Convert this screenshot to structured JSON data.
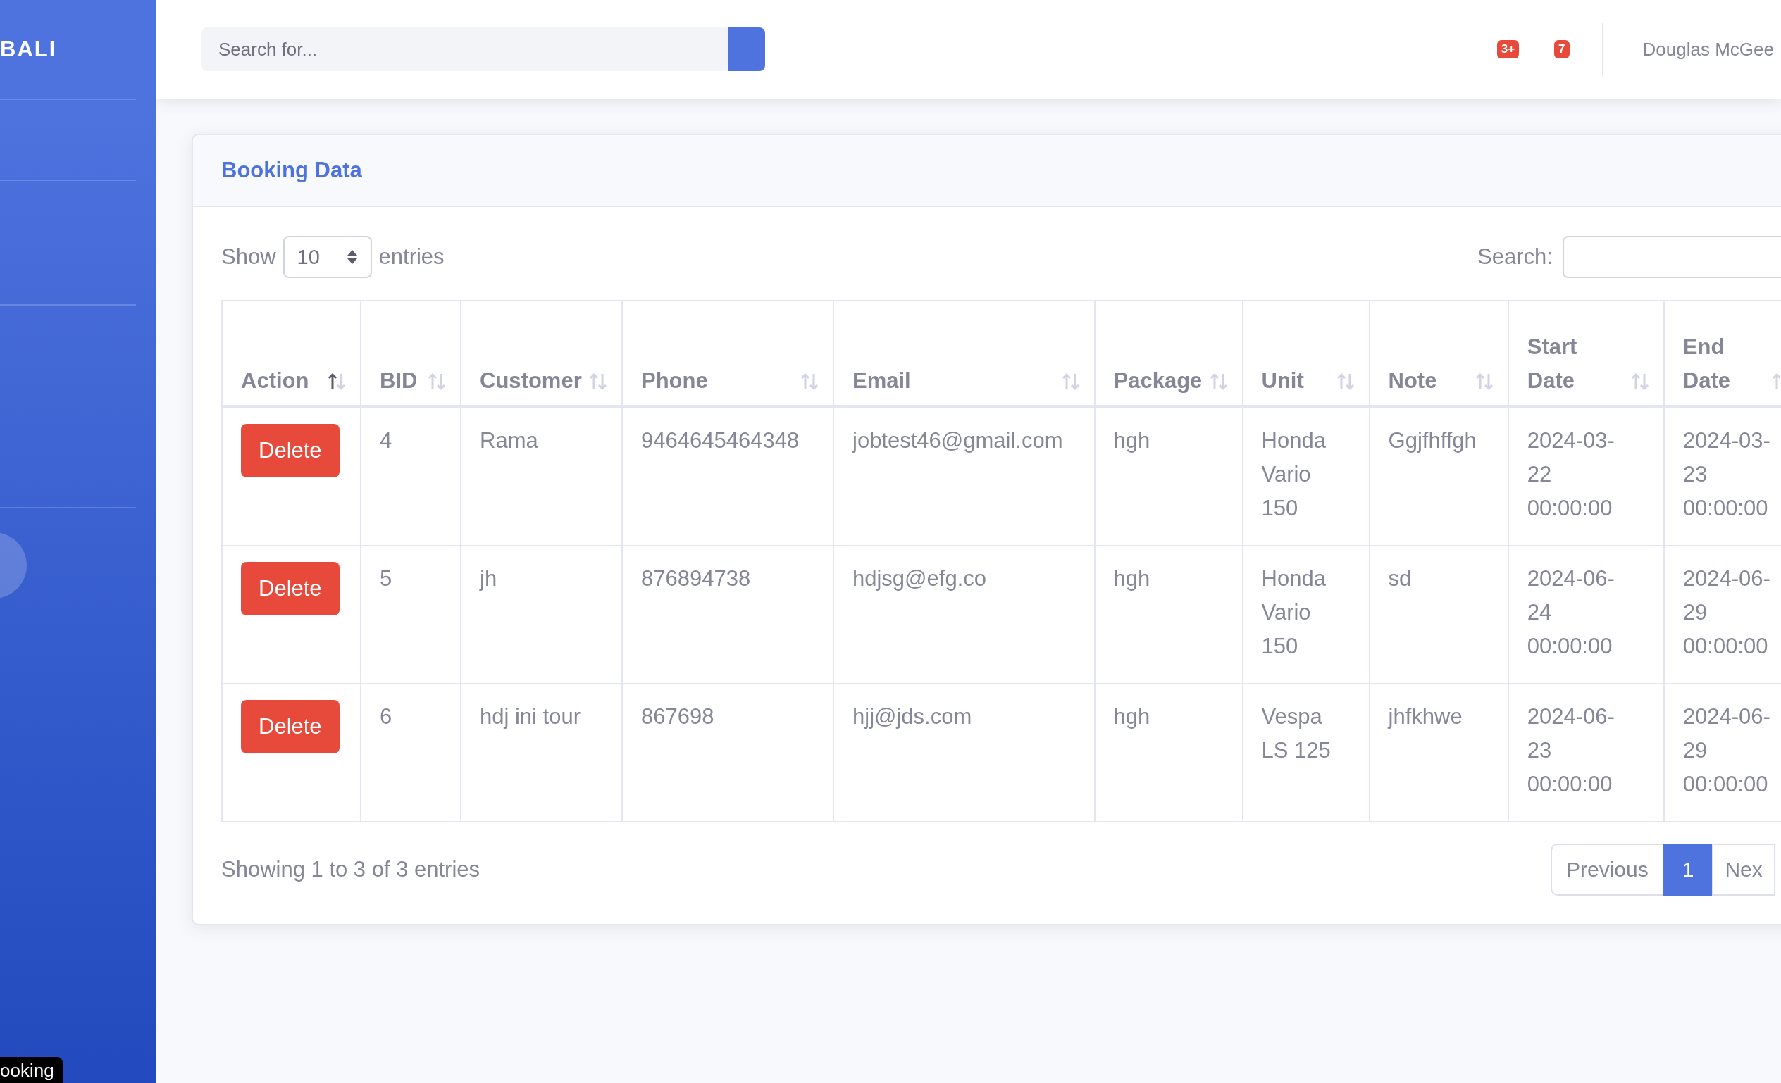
{
  "sidebar": {
    "brand": "BALI",
    "tooltip": "ooking"
  },
  "topbar": {
    "search": {
      "placeholder": "Search for..."
    },
    "alerts": [
      {
        "count": "3+"
      },
      {
        "count": "7"
      }
    ],
    "user": "Douglas McGee"
  },
  "card": {
    "title": "Booking Data",
    "length_menu": {
      "before": "Show",
      "value": "10",
      "after": "entries"
    },
    "search_label": "Search:",
    "table": {
      "columns": [
        {
          "label": "Action",
          "kind": "button",
          "sorted": true
        },
        {
          "label": "BID",
          "kind": "text",
          "sorted": false
        },
        {
          "label": "Customer",
          "kind": "text",
          "sorted": false
        },
        {
          "label": "Phone",
          "kind": "text",
          "sorted": false
        },
        {
          "label": "Email",
          "kind": "text",
          "sorted": false
        },
        {
          "label": "Package",
          "kind": "text",
          "sorted": false
        },
        {
          "label": "Unit",
          "kind": "text",
          "sorted": false
        },
        {
          "label": "Note",
          "kind": "text",
          "sorted": false
        },
        {
          "label": "Start Date",
          "kind": "text",
          "sorted": false
        },
        {
          "label": "End Date",
          "kind": "text",
          "sorted": false
        }
      ],
      "rows": [
        {
          "cells": [
            "Delete",
            "4",
            "Rama",
            "9464645464348",
            "jobtest46@gmail.com",
            "hgh",
            "Honda Vario 150",
            "Ggjfhffgh",
            "2024-03-22 00:00:00",
            "2024-03-23 00:00:00"
          ]
        },
        {
          "cells": [
            "Delete",
            "5",
            "jh",
            "876894738",
            "hdjsg@efg.co",
            "hgh",
            "Honda Vario 150",
            "sd",
            "2024-06-24 00:00:00",
            "2024-06-29 00:00:00"
          ]
        },
        {
          "cells": [
            "Delete",
            "6",
            "hdj ini tour",
            "867698",
            "hjj@jds.com",
            "hgh",
            "Vespa LS 125",
            "jhfkhwe",
            "2024-06-23 00:00:00",
            "2024-06-29 00:00:00"
          ]
        }
      ]
    },
    "info": "Showing 1 to 3 of 3 entries",
    "pagination": [
      {
        "label": "Previous",
        "selected": false
      },
      {
        "label": "1",
        "selected": true
      },
      {
        "label": "Nex",
        "selected": false
      }
    ]
  }
}
